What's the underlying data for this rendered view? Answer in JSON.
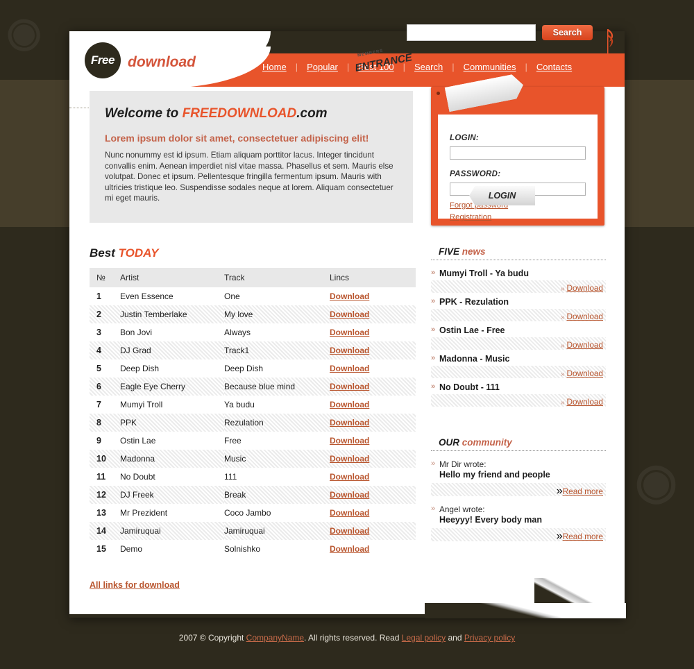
{
  "header": {
    "logo_badge": "Free",
    "logo_word": "download",
    "nav": [
      {
        "label": "Home"
      },
      {
        "label": "Popular"
      },
      {
        "label": "Best 100"
      },
      {
        "label": "Search"
      },
      {
        "label": "Communities"
      },
      {
        "label": "Contacts"
      }
    ],
    "nav_separator": "|",
    "search": {
      "value": "",
      "placeholder": "",
      "button_label": "Search"
    }
  },
  "welcome": {
    "title_prefix": "Welcome to ",
    "title_brand": "FREEDOWNLOAD",
    "title_suffix": ".com",
    "subtitle": "Lorem ipsum dolor sit amet, consectetuer adipiscing elit!",
    "body": "Nunc nonummy est id ipsum. Etiam aliquam porttitor lacus. Integer tincidunt convallis enim. Aenean imperdiet nisl vitae massa. Phasellus et sem. Mauris else volutpat. Donec et ipsum. Pellentesque fringilla fermentum ipsum. Mauris with ultricies tristique leo. Suspendisse sodales neque at lorem. Aliquam consectetuer mi eget mauris."
  },
  "login": {
    "tag_small": "MEMBERS",
    "tag_big": "ENTRANCE",
    "login_label": "LOGIN:",
    "login_value": "",
    "password_label": "PASSWORD:",
    "password_value": "",
    "forgot_link": "Forgot password",
    "registration_link": "Registration",
    "button_label": "LOGIN"
  },
  "best_today": {
    "title_prefix": "Best ",
    "title_accent": "TODAY",
    "columns": [
      "№",
      "Artist",
      "Track",
      "Lincs"
    ],
    "link_label": "Download",
    "rows": [
      {
        "no": "1",
        "artist": "Even Essence",
        "track": "One"
      },
      {
        "no": "2",
        "artist": "Justin Temberlake",
        "track": "My love"
      },
      {
        "no": "3",
        "artist": "Bon Jovi",
        "track": "Always"
      },
      {
        "no": "4",
        "artist": "DJ Grad",
        "track": "Track1"
      },
      {
        "no": "5",
        "artist": "Deep Dish",
        "track": "Deep Dish"
      },
      {
        "no": "6",
        "artist": "Eagle Eye Cherry",
        "track": "Because blue mind"
      },
      {
        "no": "7",
        "artist": "Mumyi Troll",
        "track": "Ya budu"
      },
      {
        "no": "8",
        "artist": "PPK",
        "track": "Rezulation"
      },
      {
        "no": "9",
        "artist": "Ostin Lae",
        "track": "Free"
      },
      {
        "no": "10",
        "artist": "Madonna",
        "track": "Music"
      },
      {
        "no": "11",
        "artist": "No Doubt",
        "track": "111"
      },
      {
        "no": "12",
        "artist": "DJ Freek",
        "track": "Break"
      },
      {
        "no": "13",
        "artist": "Mr Prezident",
        "track": "Coco Jambo"
      },
      {
        "no": "14",
        "artist": "Jamiruquai",
        "track": "Jamiruquai"
      },
      {
        "no": "15",
        "artist": "Demo",
        "track": "Solnishko"
      }
    ],
    "all_links_label": "All links for download"
  },
  "news": {
    "title_prefix": "FIVE ",
    "title_accent": "news",
    "link_label": "Download",
    "items": [
      {
        "title": "Mumyi Troll - Ya budu"
      },
      {
        "title": "PPK - Rezulation"
      },
      {
        "title": "Ostin Lae - Free"
      },
      {
        "title": "Madonna - Music"
      },
      {
        "title": "No Doubt - 111"
      }
    ]
  },
  "community": {
    "title_prefix": "OUR ",
    "title_accent": "community",
    "link_label": "Read more",
    "posts": [
      {
        "who": "Mr Dir wrote:",
        "message": "Hello my friend and people"
      },
      {
        "who": "Angel wrote:",
        "message": "Heeyyy! Every body man"
      }
    ]
  },
  "footer": {
    "copyright_pre": "2007 © Copyright ",
    "company_link": "CompanyName",
    "middle": ". All rights reserved. Read ",
    "legal_link": "Legal policy",
    "and": " and ",
    "privacy_link": "Privacy policy "
  },
  "colors": {
    "accent": "#e8542b",
    "link": "#b9562f",
    "page_bg": "#2e2a1d",
    "band": "#463e2b",
    "panel": "#e8e8e8"
  },
  "bullets": {
    "chevron": "»",
    "chevron_small": "»"
  }
}
